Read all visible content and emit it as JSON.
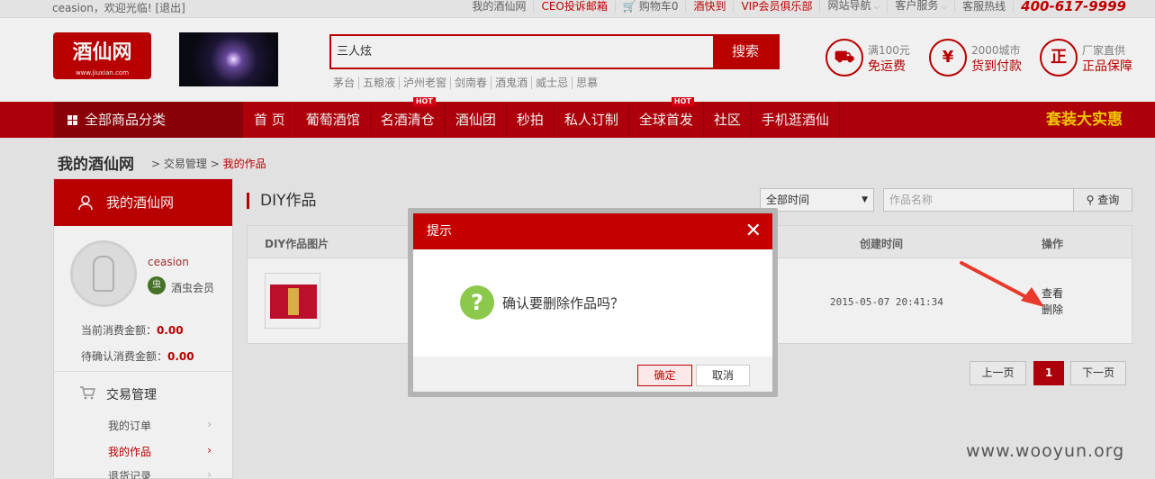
{
  "topbar": {
    "welcome": "ceasion，欢迎光临! [退出]",
    "links": [
      "我的酒仙网",
      "CEO投诉邮箱",
      "购物车0",
      "酒快到",
      "VIP会员俱乐部",
      "网站导航",
      "客户服务",
      "客服热线"
    ],
    "hotline": "400-617-9999",
    "accent": "#c40000"
  },
  "header": {
    "logo_text": "酒仙网",
    "logo_url_text": "www.jiuxian.com",
    "search_value": "三人炫",
    "search_button": "搜索",
    "hotwords": [
      "茅台",
      "五粮液",
      "泸州老窖",
      "剑南春",
      "酒鬼酒",
      "威士忌",
      "思慕"
    ],
    "promos": [
      {
        "icon": "truck-icon",
        "line1": "满100元",
        "line2": "免运费"
      },
      {
        "icon": "cash-icon",
        "line1": "2000城市",
        "line2": "货到付款"
      },
      {
        "icon": "genuine-icon",
        "line1": "厂家直供",
        "line2": "正品保障"
      }
    ]
  },
  "nav": {
    "all_categories": "全部商品分类",
    "items": [
      "首 页",
      "葡萄酒馆",
      "名酒清仓",
      "酒仙团",
      "秒拍",
      "私人订制",
      "全球首发",
      "社区",
      "手机逛酒仙"
    ],
    "hot_badge": "HOT",
    "deal": "套装大实惠"
  },
  "breadcrumb": {
    "title": "我的酒仙网",
    "path": [
      "交易管理",
      "我的作品"
    ]
  },
  "sidebar": {
    "title": "我的酒仙网",
    "username": "ceasion",
    "rank_icon_text": "虫",
    "rank": "酒虫会员",
    "current_spend_label": "当前消费金额：",
    "current_spend": "0.00",
    "pending_spend_label": "待确认消费金额：",
    "pending_spend": "0.00",
    "section": "交易管理",
    "items": [
      "我的订单",
      "我的作品",
      "退货记录"
    ]
  },
  "main": {
    "title": "DIY作品",
    "time_filter": "全部时间",
    "name_placeholder": "作品名称",
    "query_button": "查询",
    "columns": [
      "DIY作品图片",
      "创建时间",
      "操作"
    ],
    "rows": [
      {
        "created": "2015-05-07 20:41:34",
        "actions": [
          "查看",
          "删除"
        ]
      }
    ],
    "pager": {
      "prev": "上一页",
      "current": "1",
      "next": "下一页"
    }
  },
  "dialog": {
    "title": "提示",
    "message": "确认要删除作品吗？",
    "ok": "确定",
    "cancel": "取消"
  },
  "watermark": "www.wooyun.org"
}
